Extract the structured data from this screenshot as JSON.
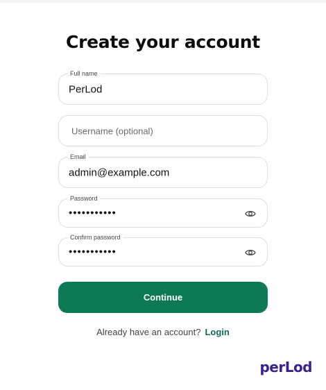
{
  "page": {
    "title": "Create your account"
  },
  "form": {
    "full_name": {
      "label": "Full name",
      "value": "PerLod"
    },
    "username": {
      "placeholder": "Username (optional)",
      "value": ""
    },
    "email": {
      "label": "Email",
      "value": "admin@example.com"
    },
    "password": {
      "label": "Password",
      "masked_value": "•••••••••••",
      "icon": "eye-icon"
    },
    "confirm_password": {
      "label": "Confirm password",
      "masked_value": "•••••••••••",
      "icon": "eye-icon"
    }
  },
  "actions": {
    "continue_label": "Continue",
    "login_prompt": "Already have an account?",
    "login_link": "Login"
  },
  "brand": {
    "logo_text": "perLod"
  },
  "colors": {
    "primary": "#0e7a55",
    "link": "#0e6b57",
    "brand": "#3a1f8f",
    "border": "#dcdcdc"
  }
}
